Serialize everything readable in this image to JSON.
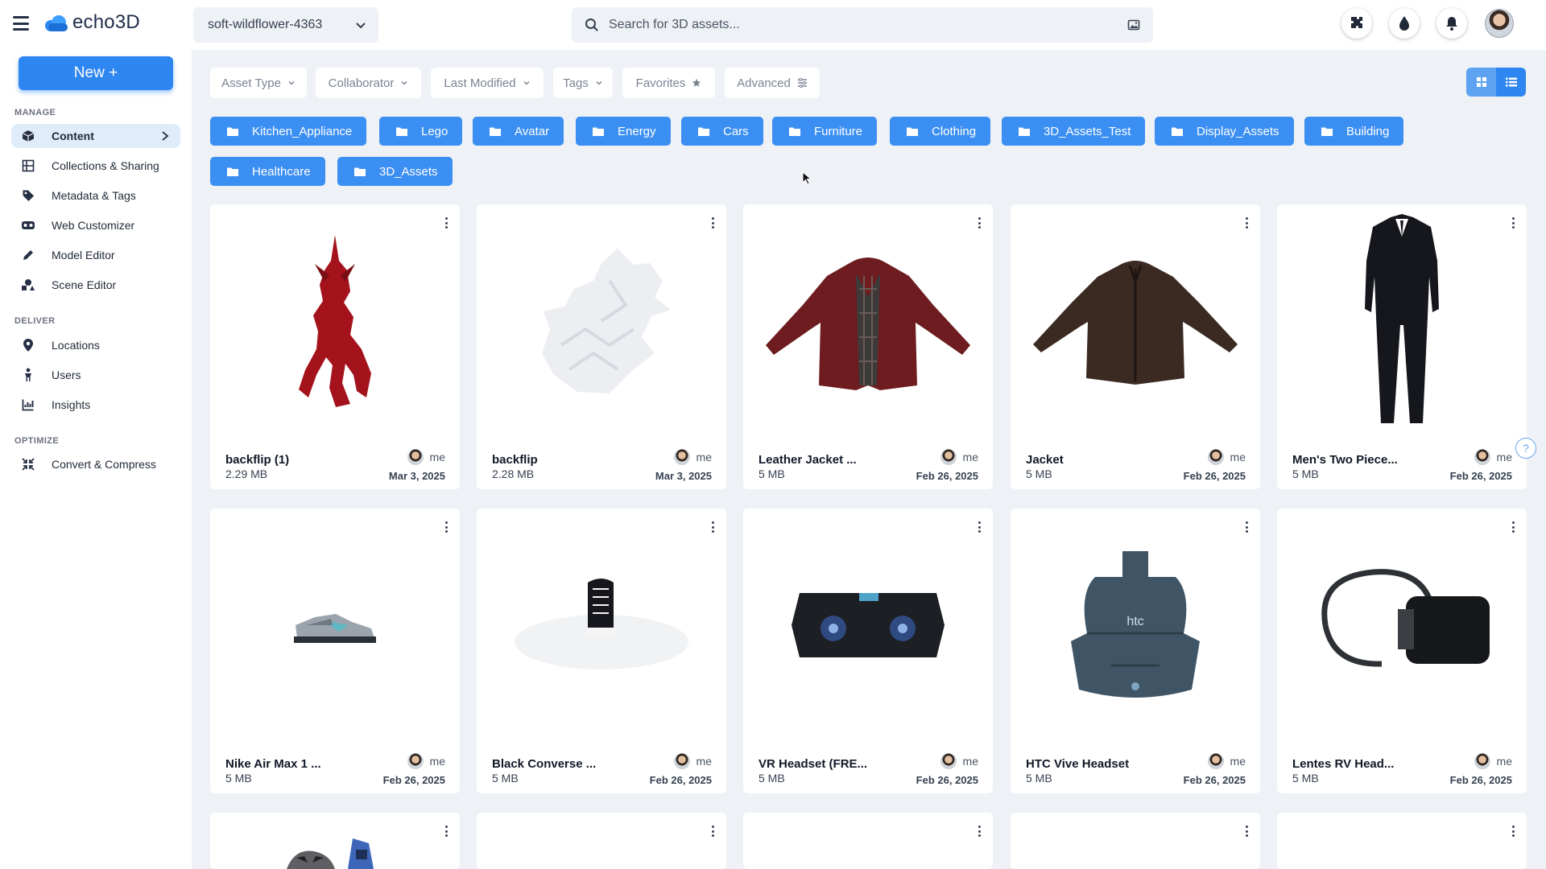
{
  "topbar": {
    "logo_text": "echo3D",
    "project": "soft-wildflower-4363",
    "search_placeholder": "Search for 3D assets...",
    "icons": [
      "puzzle-icon",
      "droplet-icon",
      "bell-icon",
      "user-avatar"
    ]
  },
  "sidebar": {
    "new_button": "New +",
    "sections": [
      {
        "title": "MANAGE",
        "items": [
          {
            "label": "Content",
            "icon": "cube-icon",
            "active": true
          },
          {
            "label": "Collections & Sharing",
            "icon": "grid-icon"
          },
          {
            "label": "Metadata & Tags",
            "icon": "tag-icon"
          },
          {
            "label": "Web Customizer",
            "icon": "vr-glasses-icon"
          },
          {
            "label": "Model Editor",
            "icon": "pencil-icon"
          },
          {
            "label": "Scene Editor",
            "icon": "shapes-icon"
          }
        ]
      },
      {
        "title": "DELIVER",
        "items": [
          {
            "label": "Locations",
            "icon": "map-pin-icon"
          },
          {
            "label": "Users",
            "icon": "person-icon"
          },
          {
            "label": "Insights",
            "icon": "chart-icon"
          }
        ]
      },
      {
        "title": "OPTIMIZE",
        "items": [
          {
            "label": "Convert & Compress",
            "icon": "compress-icon"
          }
        ]
      }
    ]
  },
  "filters": [
    "Asset Type",
    "Collaborator",
    "Last Modified",
    "Tags",
    "Favorites",
    "Advanced"
  ],
  "folders": [
    "Kitchen_Appliance",
    "Lego",
    "Avatar",
    "Energy",
    "Cars",
    "Furniture",
    "Clothing",
    "3D_Assets_Test",
    "Display_Assets",
    "Building",
    "Healthcare",
    "3D_Assets"
  ],
  "assets": [
    {
      "name": "backflip (1)",
      "size": "2.29 MB",
      "owner": "me",
      "date": "Mar 3, 2025",
      "thumb": "red-dragon"
    },
    {
      "name": "backflip",
      "size": "2.28 MB",
      "owner": "me",
      "date": "Mar 3, 2025",
      "thumb": "white-dragon"
    },
    {
      "name": "Leather Jacket ...",
      "size": "5 MB",
      "owner": "me",
      "date": "Feb 26, 2025",
      "thumb": "red-jacket"
    },
    {
      "name": "Jacket",
      "size": "5 MB",
      "owner": "me",
      "date": "Feb 26, 2025",
      "thumb": "brown-jacket"
    },
    {
      "name": "Men's Two Piece...",
      "size": "5 MB",
      "owner": "me",
      "date": "Feb 26, 2025",
      "thumb": "suit"
    },
    {
      "name": "Nike Air Max 1 ...",
      "size": "5 MB",
      "owner": "me",
      "date": "Feb 26, 2025",
      "thumb": "sneaker"
    },
    {
      "name": "Black Converse ...",
      "size": "5 MB",
      "owner": "me",
      "date": "Feb 26, 2025",
      "thumb": "converse"
    },
    {
      "name": "VR Headset (FRE...",
      "size": "5 MB",
      "owner": "me",
      "date": "Feb 26, 2025",
      "thumb": "vr-headset"
    },
    {
      "name": "HTC Vive Headset",
      "size": "5 MB",
      "owner": "me",
      "date": "Feb 26, 2025",
      "thumb": "htc-vive"
    },
    {
      "name": "Lentes RV Head...",
      "size": "5 MB",
      "owner": "me",
      "date": "Feb 26, 2025",
      "thumb": "oculus"
    },
    {
      "name": "",
      "size": "",
      "owner": "",
      "date": "",
      "thumb": "raccoon"
    },
    {
      "name": "",
      "size": "",
      "owner": "",
      "date": "",
      "thumb": "empty"
    },
    {
      "name": "",
      "size": "",
      "owner": "",
      "date": "",
      "thumb": "empty"
    },
    {
      "name": "",
      "size": "",
      "owner": "",
      "date": "",
      "thumb": "empty"
    },
    {
      "name": "",
      "size": "",
      "owner": "",
      "date": "",
      "thumb": "empty"
    }
  ],
  "htc_logo_text": "htc",
  "help_text": "?",
  "colors": {
    "accent": "#2e86f0",
    "folder": "#3c8ff2",
    "background": "#eef1f6",
    "active_nav": "#e1ecfb"
  }
}
